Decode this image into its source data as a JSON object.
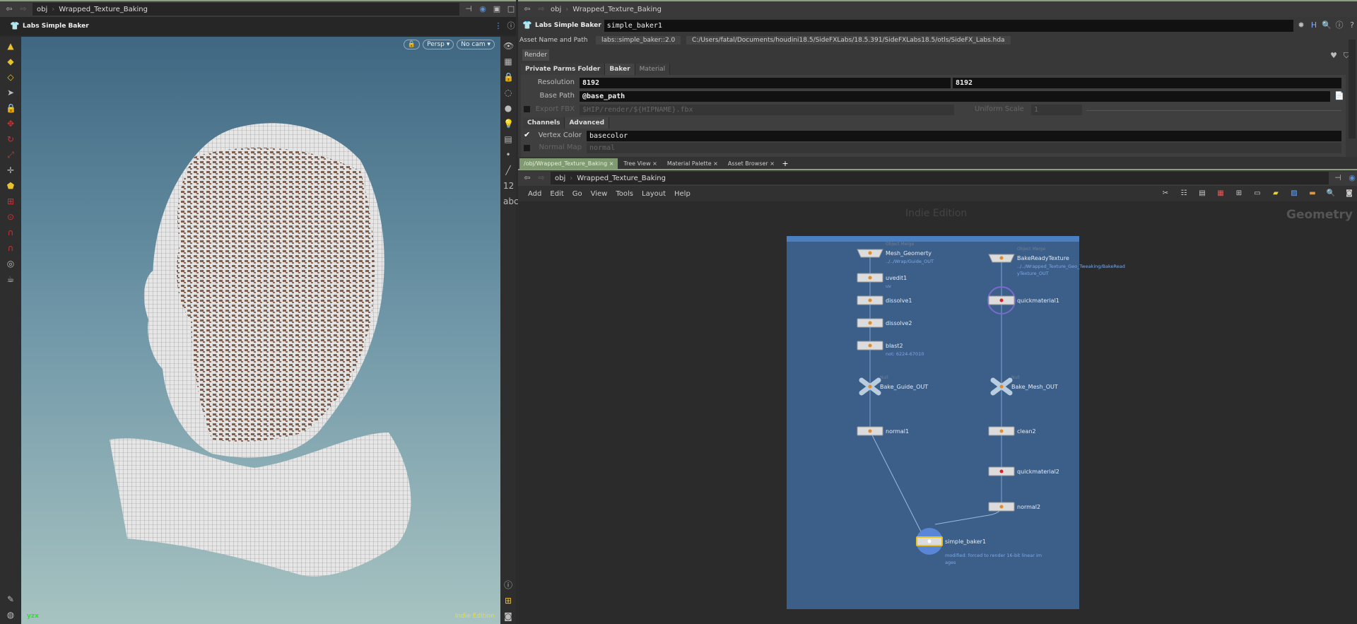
{
  "left": {
    "path": {
      "root": "obj",
      "network": "Wrapped_Texture_Baking"
    },
    "header": "Labs Simple Baker",
    "viewport": {
      "camera_mode": "Persp",
      "camera": "No cam",
      "watermark": "Indie Edition",
      "axis": "yzx"
    }
  },
  "params": {
    "path": {
      "root": "obj",
      "network": "Wrapped_Texture_Baking"
    },
    "node_type": "Labs Simple Baker",
    "node_name": "simple_baker1",
    "asset_label": "Asset Name and Path",
    "asset_name": "labs::simple_baker::2.0",
    "asset_path": "C:/Users/fatal/Documents/houdini18.5/SideFXLabs/18.5.391/SideFXLabs18.5/otls/SideFX_Labs.hda",
    "render_label": "Render",
    "tabs": [
      "Private Parms Folder",
      "Baker",
      "Material"
    ],
    "resolution_label": "Resolution",
    "resolution_x": "8192",
    "resolution_y": "8192",
    "base_path_label": "Base Path",
    "base_path": "@base_path",
    "export_fbx_label": "Export FBX",
    "export_fbx": "$HIP/render/${HIPNAME}.fbx",
    "uniform_scale_label": "Uniform Scale",
    "uniform_scale": "1",
    "subtabs": [
      "Channels",
      "Advanced"
    ],
    "vertex_color_label": "Vertex Color",
    "vertex_color": "basecolor",
    "vertex_color_checked": true,
    "normal_map_label": "Normal Map",
    "normal_map": "normal",
    "normal_map_checked": false
  },
  "pane_tabs": [
    "/obj/Wrapped_Texture_Baking",
    "Tree View",
    "Material Palette",
    "Asset Browser"
  ],
  "network": {
    "path": {
      "root": "obj",
      "network": "Wrapped_Texture_Baking"
    },
    "menu": [
      "Add",
      "Edit",
      "Go",
      "View",
      "Tools",
      "Layout",
      "Help"
    ],
    "watermark": "Indie Edition",
    "context": "Geometry",
    "nodes": [
      {
        "name": "Mesh_Geomerty",
        "type": "Object Merge",
        "comment": "../../Wrap/Guide_OUT"
      },
      {
        "name": "uvedit1",
        "comment": "uv"
      },
      {
        "name": "dissolve1"
      },
      {
        "name": "dissolve2"
      },
      {
        "name": "blast2",
        "comment": "not: 6224-67010"
      },
      {
        "name": "Bake_Guide_OUT",
        "type": "Null"
      },
      {
        "name": "normal1"
      },
      {
        "name": "BakeReadyTexture",
        "type": "Object Merge",
        "comment": "../../Wrapped_Texture_Geo_Tweaking/BakeReadyTexture_OUT"
      },
      {
        "name": "quickmaterial1"
      },
      {
        "name": "Bake_Mesh_OUT",
        "type": "Null"
      },
      {
        "name": "clean2"
      },
      {
        "name": "quickmaterial2"
      },
      {
        "name": "normal2"
      },
      {
        "name": "simple_baker1",
        "comment": "modified: forced to render 16-bit linear images"
      }
    ]
  }
}
